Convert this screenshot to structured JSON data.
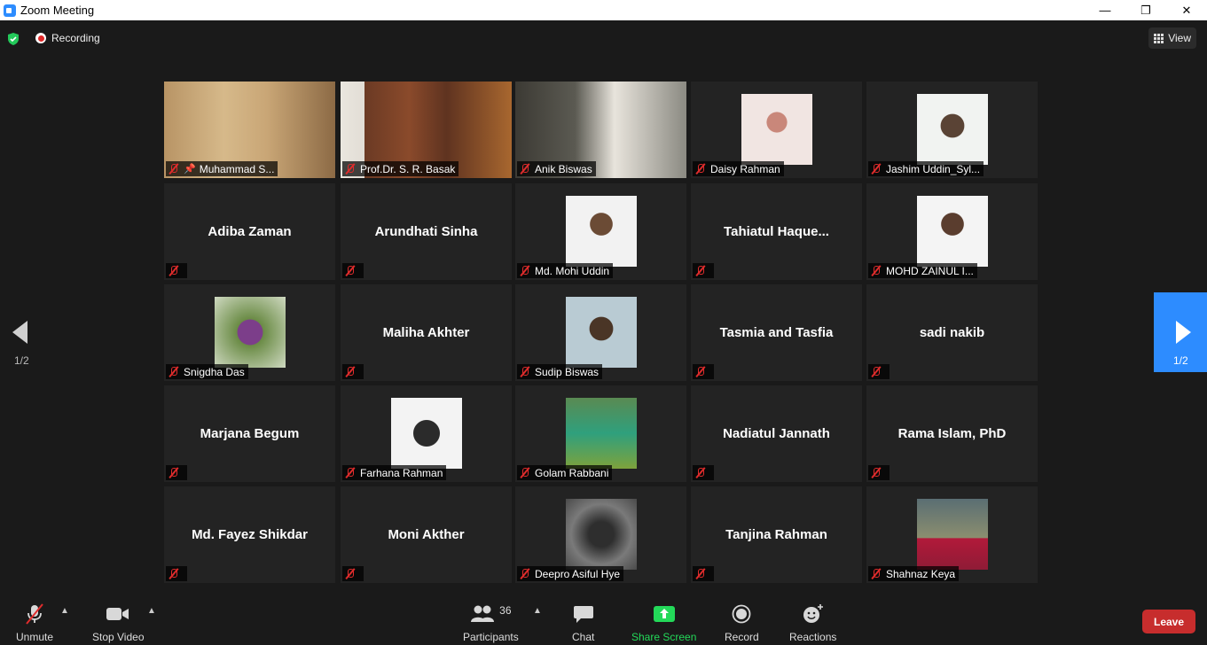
{
  "window": {
    "title": "Zoom Meeting",
    "minimize": "—",
    "restore": "❐",
    "close": "✕"
  },
  "topbar": {
    "recording_label": "Recording",
    "view_label": "View"
  },
  "pager": {
    "left_page": "1/2",
    "right_page": "1/2"
  },
  "tiles": [
    {
      "name": "Muhammad S...",
      "pinned": true,
      "video": true
    },
    {
      "name": "Prof.Dr. S. R. Basak",
      "video": true
    },
    {
      "name": "Anik Biswas",
      "video": true,
      "active": true
    },
    {
      "name": "Daisy Rahman",
      "photo": true
    },
    {
      "name": "Jashim Uddin_Syl...",
      "photo": true
    },
    {
      "name": "Adiba Zaman"
    },
    {
      "name": "Arundhati Sinha"
    },
    {
      "name": "Md. Mohi Uddin",
      "photo": true
    },
    {
      "name": "Tahiatul  Haque..."
    },
    {
      "name": "MOHD ZAINUL I...",
      "photo": true
    },
    {
      "name": "Snigdha Das",
      "photo": true
    },
    {
      "name": "Maliha Akhter"
    },
    {
      "name": "Sudip Biswas",
      "photo": true
    },
    {
      "name": "Tasmia and Tasfia"
    },
    {
      "name": "sadi nakib"
    },
    {
      "name": "Marjana Begum"
    },
    {
      "name": "Farhana Rahman",
      "photo": true
    },
    {
      "name": "Golam Rabbani",
      "photo": true
    },
    {
      "name": "Nadiatul Jannath"
    },
    {
      "name": "Rama Islam, PhD"
    },
    {
      "name": "Md. Fayez Shikdar"
    },
    {
      "name": "Moni Akther"
    },
    {
      "name": "Deepro Asiful Hye",
      "photo": true
    },
    {
      "name": "Tanjina Rahman"
    },
    {
      "name": "Shahnaz Keya",
      "photo": true
    }
  ],
  "toolbar": {
    "unmute": "Unmute",
    "stop_video": "Stop Video",
    "participants": "Participants",
    "participants_count": "36",
    "chat": "Chat",
    "share_screen": "Share Screen",
    "record": "Record",
    "reactions": "Reactions",
    "leave": "Leave"
  },
  "colors": {
    "accent": "#2d8cff",
    "share": "#23d959",
    "leave": "#c72d2d",
    "active_speaker": "#b9e06a",
    "muted": "#e02c2c"
  }
}
